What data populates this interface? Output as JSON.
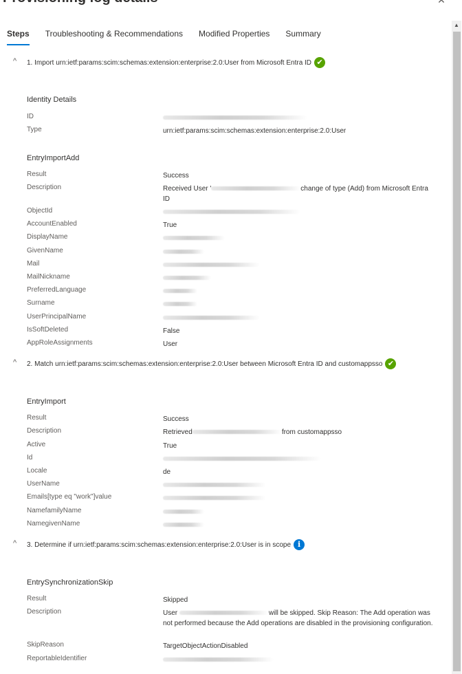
{
  "header": {
    "title": "Provisioning log details",
    "close_label": "✕"
  },
  "tabs": [
    {
      "label": "Steps",
      "active": true
    },
    {
      "label": "Troubleshooting & Recommendations",
      "active": false
    },
    {
      "label": "Modified Properties",
      "active": false
    },
    {
      "label": "Summary",
      "active": false
    }
  ],
  "steps": [
    {
      "header": "1. Import urn:ietf:params:scim:schemas:extension:enterprise:2.0:User from Microsoft Entra ID",
      "status_icon": "check-circle-icon",
      "status_glyph": "✔",
      "sections": [
        {
          "title": "Identity Details",
          "rows": [
            {
              "key": "ID",
              "value": "",
              "redacted": true
            },
            {
              "key": "Type",
              "value": "urn:ietf:params:scim:schemas:extension:enterprise:2.0:User"
            }
          ]
        },
        {
          "title": "EntryImportAdd",
          "rows": [
            {
              "key": "Result",
              "value": "Success"
            },
            {
              "key": "Description",
              "value_prefix": "Received User '",
              "value_suffix": "change of type (Add) from Microsoft Entra ID",
              "redacted_inline": true
            },
            {
              "key": "ObjectId",
              "value": "",
              "redacted": true
            },
            {
              "key": "AccountEnabled",
              "value": "True"
            },
            {
              "key": "DisplayName",
              "value": "",
              "redacted": true
            },
            {
              "key": "GivenName",
              "value": "",
              "redacted": true
            },
            {
              "key": "Mail",
              "value": "",
              "redacted": true
            },
            {
              "key": "MailNickname",
              "value": "",
              "redacted": true
            },
            {
              "key": "PreferredLanguage",
              "value": "",
              "redacted": true
            },
            {
              "key": "Surname",
              "value": "",
              "redacted": true
            },
            {
              "key": "UserPrincipalName",
              "value": "",
              "redacted": true
            },
            {
              "key": "IsSoftDeleted",
              "value": "False"
            },
            {
              "key": "AppRoleAssignments",
              "value": "User"
            }
          ]
        }
      ]
    },
    {
      "header": "2. Match urn:ietf:params:scim:schemas:extension:enterprise:2.0:User between Microsoft Entra ID and customappsso",
      "status_icon": "check-circle-icon",
      "status_glyph": "✔",
      "sections": [
        {
          "title": "EntryImport",
          "rows": [
            {
              "key": "Result",
              "value": "Success"
            },
            {
              "key": "Description",
              "value_prefix": "Retrieved",
              "value_suffix": "from customappsso",
              "redacted_inline": true
            },
            {
              "key": "Active",
              "value": "True"
            },
            {
              "key": "Id",
              "value": "",
              "redacted": true
            },
            {
              "key": "Locale",
              "value": "de"
            },
            {
              "key": "UserName",
              "value": "",
              "redacted": true
            },
            {
              "key": "Emails[type eq \"work\"]value",
              "value": "",
              "redacted": true
            },
            {
              "key": "NamefamilyName",
              "value": "",
              "redacted": true
            },
            {
              "key": "NamegivenName",
              "value": "",
              "redacted": true
            }
          ]
        }
      ]
    },
    {
      "header": "3. Determine if urn:ietf:params:scim:schemas:extension:enterprise:2.0:User is in scope",
      "status_icon": "info-circle-icon",
      "status_glyph": "i",
      "sections": [
        {
          "title": "EntrySynchronizationSkip",
          "rows": [
            {
              "key": "Result",
              "value": "Skipped"
            },
            {
              "key": "Description",
              "value_prefix": "User ",
              "value_suffix": "will be skipped. Skip Reason: The Add operation was not performed because the Add operations are disabled in the provisioning configuration.",
              "redacted_inline": true
            },
            {
              "key": "SkipReason",
              "value": "TargetObjectActionDisabled"
            },
            {
              "key": "ReportableIdentifier",
              "value": "",
              "redacted": true
            }
          ]
        }
      ]
    }
  ]
}
